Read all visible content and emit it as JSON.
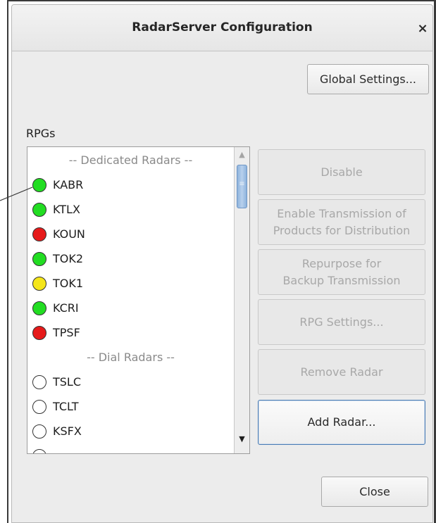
{
  "window": {
    "title": "RadarServer Configuration",
    "close_symbol": "×"
  },
  "buttons": {
    "global_settings": "Global Settings...",
    "disable": "Disable",
    "enable_transmission_line1": "Enable Transmission of",
    "enable_transmission_line2": "Products for Distribution",
    "repurpose_line1": "Repurpose for",
    "repurpose_line2": "Backup Transmission",
    "rpg_settings": "RPG Settings...",
    "remove_radar": "Remove Radar",
    "add_radar": "Add Radar...",
    "close": "Close"
  },
  "rpgs": {
    "label": "RPGs",
    "dedicated_header": "-- Dedicated Radars --",
    "dial_header": "-- Dial Radars --",
    "dedicated": [
      {
        "name": "KABR",
        "status_color": "#22dd22"
      },
      {
        "name": "KTLX",
        "status_color": "#22dd22"
      },
      {
        "name": "KOUN",
        "status_color": "#e61a1a"
      },
      {
        "name": "TOK2",
        "status_color": "#22dd22"
      },
      {
        "name": "TOK1",
        "status_color": "#f5e61a"
      },
      {
        "name": "KCRI",
        "status_color": "#22dd22"
      },
      {
        "name": "TPSF",
        "status_color": "#e61a1a"
      }
    ],
    "dial": [
      {
        "name": "TSLC",
        "status_color": "#ffffff"
      },
      {
        "name": "TCLT",
        "status_color": "#ffffff"
      },
      {
        "name": "KSFX",
        "status_color": "#ffffff"
      }
    ]
  },
  "scrollbar": {
    "up_icon": "▲",
    "down_icon": "▼",
    "grip_icon": "≡"
  },
  "colors": {
    "focus_border": "#4a7cb4",
    "thumb": "#8fb3dd"
  }
}
